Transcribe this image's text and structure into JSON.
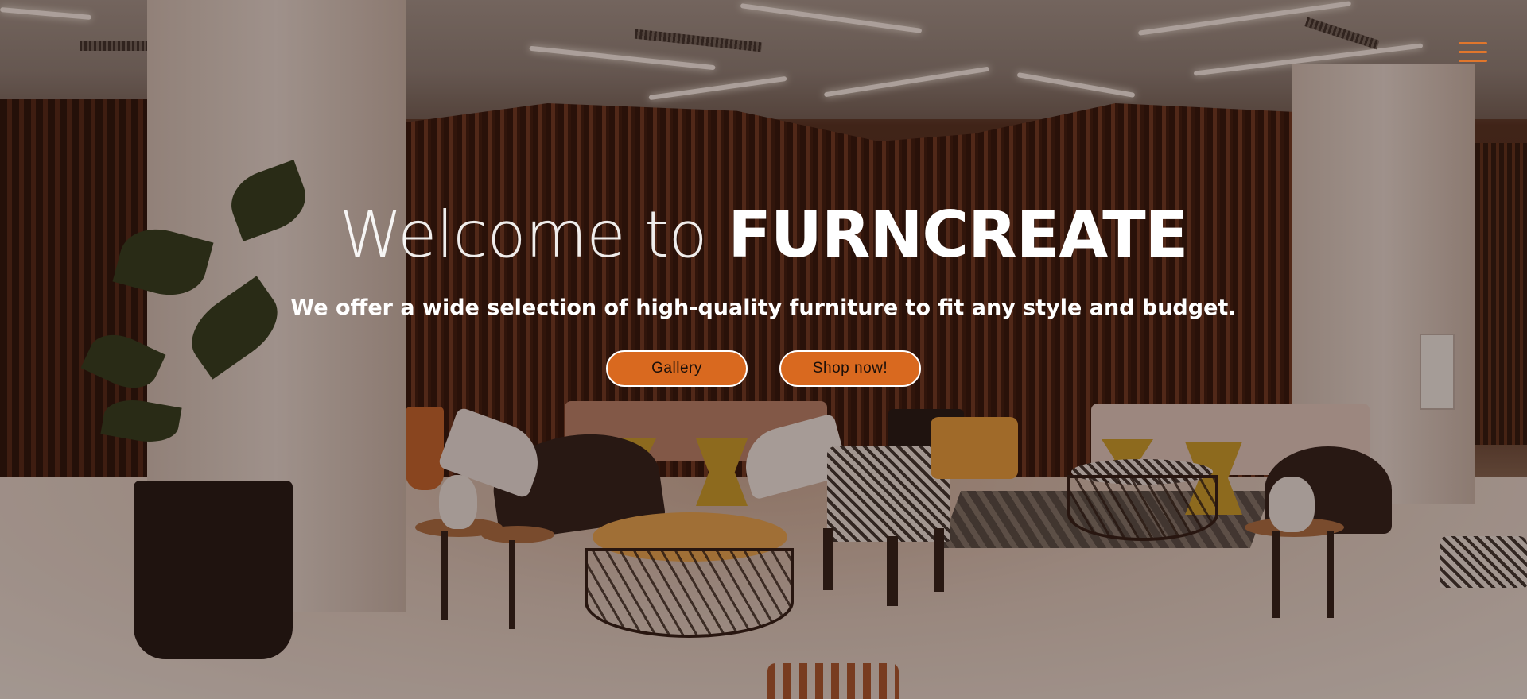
{
  "hero": {
    "title_light": "Welcome to",
    "title_brand": "FURNCREATE",
    "subtitle": "We offer a wide selection of high-quality furniture to fit any style and budget.",
    "buttons": [
      {
        "label": "Gallery"
      },
      {
        "label": "Shop now!"
      }
    ]
  },
  "nav": {
    "menu_icon": "hamburger-menu-icon"
  },
  "colors": {
    "accent": "#d9691f",
    "menu_icon": "#e0762c",
    "text": "#ffffff"
  }
}
